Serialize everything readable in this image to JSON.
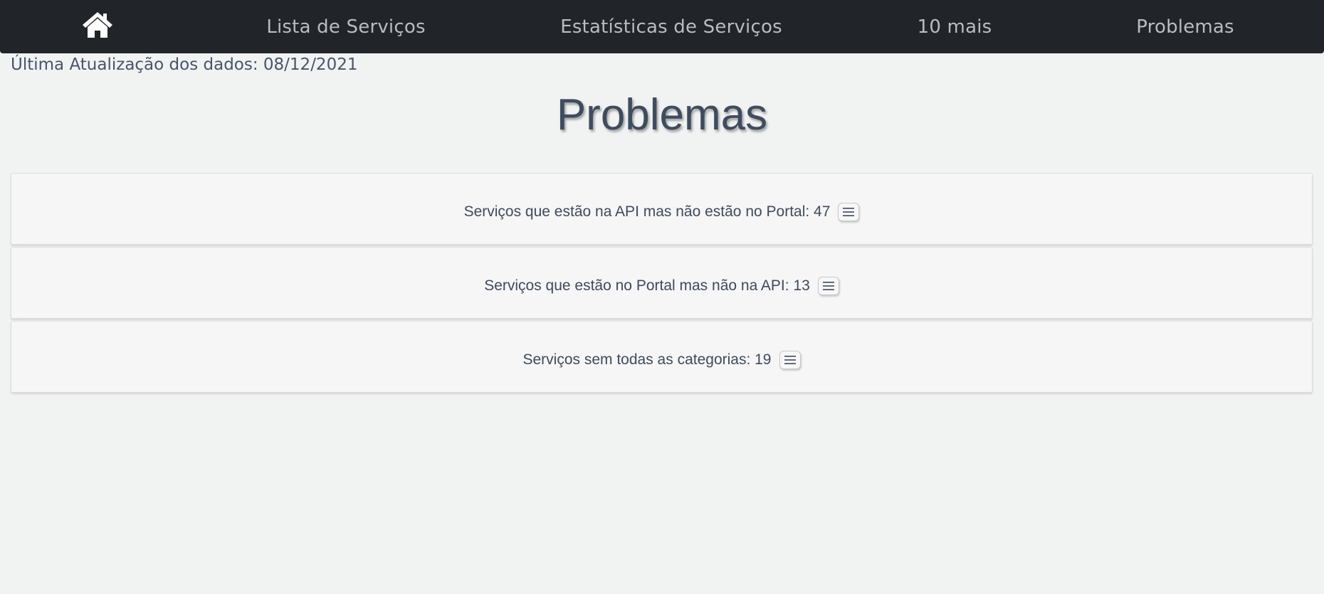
{
  "nav": {
    "home_icon": "home-icon",
    "items": [
      {
        "label": "Lista de Serviços"
      },
      {
        "label": "Estatísticas de Serviços"
      },
      {
        "label": "10 mais"
      },
      {
        "label": "Problemas"
      }
    ]
  },
  "last_update": "Última Atualização dos dados: 08/12/2021",
  "title": "Problemas",
  "problems": [
    {
      "label": "Serviços que estão na API mas não estão no Portal: 47",
      "icon": "list-icon"
    },
    {
      "label": "Serviços que estão no Portal mas não na API: 13",
      "icon": "list-icon"
    },
    {
      "label": "Serviços sem todas as categorias: 19",
      "icon": "list-icon"
    }
  ],
  "colors": {
    "navbar_bg": "#212529",
    "nav_text": "#b9bcc0",
    "page_bg": "#f1f3f2",
    "text": "#3f4f63",
    "card_bg": "#f6f6f6"
  }
}
